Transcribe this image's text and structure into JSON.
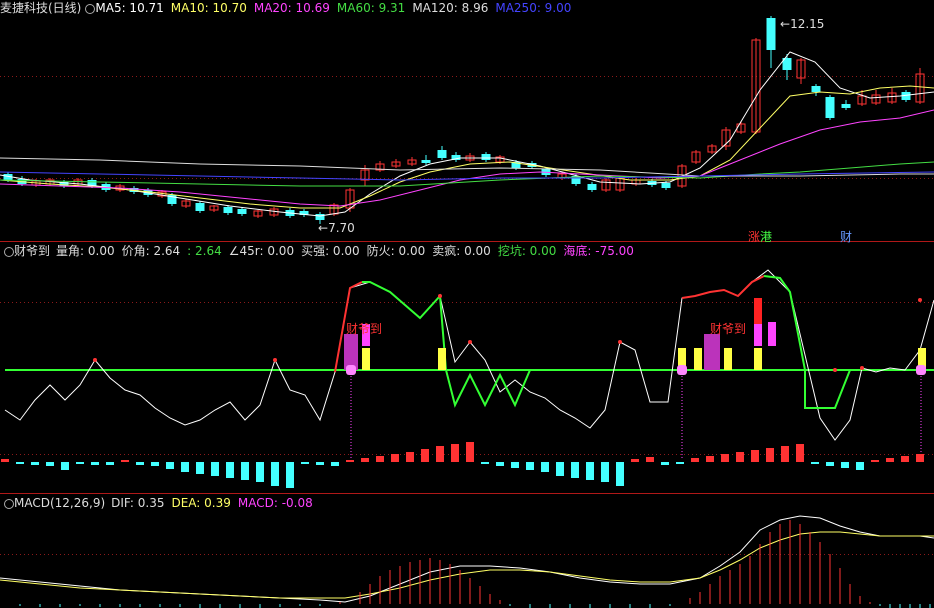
{
  "main_panel": {
    "title": "麦捷科技(日线)",
    "ma": [
      {
        "label": "MA5: 10.71",
        "color": "#ffffff"
      },
      {
        "label": "MA10: 10.70",
        "color": "#ffff66"
      },
      {
        "label": "MA20: 10.69",
        "color": "#ff44ff"
      },
      {
        "label": "MA60: 9.31",
        "color": "#44dd44"
      },
      {
        "label": "MA120: 8.96",
        "color": "#dddddd"
      },
      {
        "label": "MA250: 9.00",
        "color": "#4444ff"
      }
    ],
    "high_label": "12.15",
    "low_label": "7.70",
    "markers": [
      {
        "text": "涨",
        "color": "#ff3333"
      },
      {
        "text": "港",
        "color": "#44ff44"
      },
      {
        "text": "财",
        "color": "#6699ff"
      }
    ]
  },
  "indicator_panel": {
    "name": "财爷到",
    "items": [
      {
        "label": "量角: 0.00",
        "color": "#dddddd"
      },
      {
        "label": "价角: 2.64",
        "color": "#dddddd"
      },
      {
        "label": ": 2.64",
        "color": "#44dd44"
      },
      {
        "label": "∠45r: 0.00",
        "color": "#dddddd"
      },
      {
        "label": "买强: 0.00",
        "color": "#dddddd"
      },
      {
        "label": "防火: 0.00",
        "color": "#dddddd"
      },
      {
        "label": "卖疯: 0.00",
        "color": "#dddddd"
      },
      {
        "label": "挖坑: 0.00",
        "color": "#44dd44"
      },
      {
        "label": "海底: -75.00",
        "color": "#ff44ff"
      }
    ],
    "signal_text": "财爷到"
  },
  "macd_panel": {
    "name": "MACD(12,26,9)",
    "items": [
      {
        "label": "DIF: 0.35",
        "color": "#dddddd"
      },
      {
        "label": "DEA: 0.39",
        "color": "#ffff66"
      },
      {
        "label": "MACD: -0.08",
        "color": "#ff44ff"
      }
    ]
  },
  "colors": {
    "up": "#ff3333",
    "down": "#44ffff",
    "grid": "#8b1a1a"
  }
}
